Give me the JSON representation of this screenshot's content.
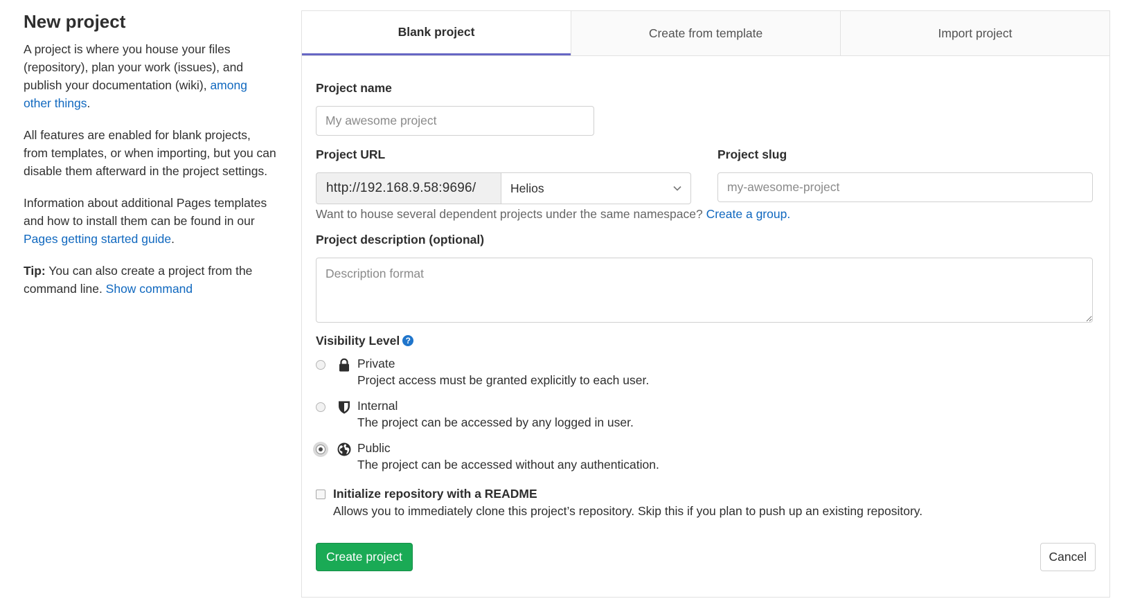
{
  "sidebar": {
    "title": "New project",
    "p1_text": "A project is where you house your files (repository), plan your work (issues), and publish your documentation (wiki), ",
    "p1_link": "among other things",
    "p1_end": ".",
    "p2_text": "All features are enabled for blank projects, from templates, or when importing, but you can disable them afterward in the project settings.",
    "p3_text": "Information about additional Pages templates and how to install them can be found in our ",
    "p3_link": "Pages getting started guide",
    "p3_end": ".",
    "tip_label": "Tip:",
    "tip_text": " You can also create a project from the command line. ",
    "tip_link": "Show command"
  },
  "tabs": [
    {
      "label": "Blank project",
      "active": true
    },
    {
      "label": "Create from template",
      "active": false
    },
    {
      "label": "Import project",
      "active": false
    }
  ],
  "form": {
    "name_label": "Project name",
    "name_placeholder": "My awesome project",
    "url_label": "Project URL",
    "url_prefix": "http://192.168.9.58:9696/",
    "namespace_selected": "Helios",
    "slug_label": "Project slug",
    "slug_placeholder": "my-awesome-project",
    "namespace_help": "Want to house several dependent projects under the same namespace? ",
    "namespace_help_link": "Create a group.",
    "description_label": "Project description (optional)",
    "description_placeholder": "Description format",
    "visibility_label": "Visibility Level",
    "visibility_help_icon": "question-circle-icon",
    "visibility_options": [
      {
        "title": "Private",
        "desc": "Project access must be granted explicitly to each user.",
        "icon": "lock-icon",
        "checked": false
      },
      {
        "title": "Internal",
        "desc": "The project can be accessed by any logged in user.",
        "icon": "shield-icon",
        "checked": false
      },
      {
        "title": "Public",
        "desc": "The project can be accessed without any authentication.",
        "icon": "globe-icon",
        "checked": true
      }
    ],
    "readme_title": "Initialize repository with a README",
    "readme_desc": "Allows you to immediately clone this project’s repository. Skip this if you plan to push up an existing repository.",
    "create_label": "Create project",
    "cancel_label": "Cancel"
  },
  "colors": {
    "accent_tab": "#6666c4",
    "link": "#1068bf",
    "primary_button": "#1aaa55"
  }
}
